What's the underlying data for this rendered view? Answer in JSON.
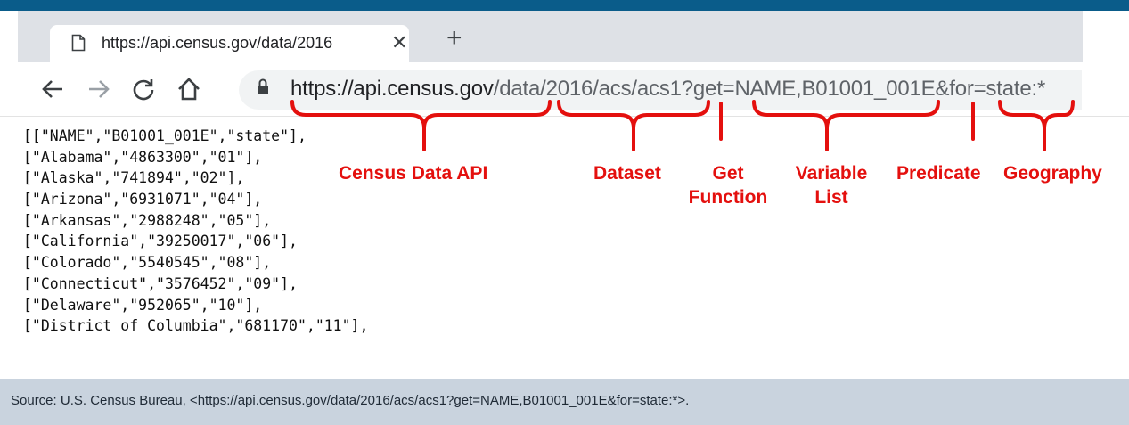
{
  "tab": {
    "title": "https://api.census.gov/data/2016"
  },
  "address_bar": {
    "host_part": "https://api.census.gov",
    "path_part": "/data/2016/acs/acs1?get=NAME,B01001_001E&for=state:*"
  },
  "json_lines": [
    "[[\"NAME\",\"B01001_001E\",\"state\"],",
    "[\"Alabama\",\"4863300\",\"01\"],",
    "[\"Alaska\",\"741894\",\"02\"],",
    "[\"Arizona\",\"6931071\",\"04\"],",
    "[\"Arkansas\",\"2988248\",\"05\"],",
    "[\"California\",\"39250017\",\"06\"],",
    "[\"Colorado\",\"5540545\",\"08\"],",
    "[\"Connecticut\",\"3576452\",\"09\"],",
    "[\"Delaware\",\"952065\",\"10\"],",
    "[\"District of Columbia\",\"681170\",\"11\"],"
  ],
  "annotations": {
    "census_data_api": "Census Data API",
    "dataset": "Dataset",
    "get_function": "Get\nFunction",
    "variable_list": "Variable\nList",
    "predicate": "Predicate",
    "geography": "Geography"
  },
  "annotation_color": "#e4100e",
  "footer": {
    "source": "Source: U.S. Census Bureau, <https://api.census.gov/data/2016/acs/acs1?get=NAME,B01001_001E&for=state:*>."
  },
  "icons": [
    "document-icon",
    "close-icon",
    "plus-icon",
    "back-arrow-icon",
    "forward-arrow-icon",
    "reload-icon",
    "home-icon",
    "lock-icon"
  ]
}
